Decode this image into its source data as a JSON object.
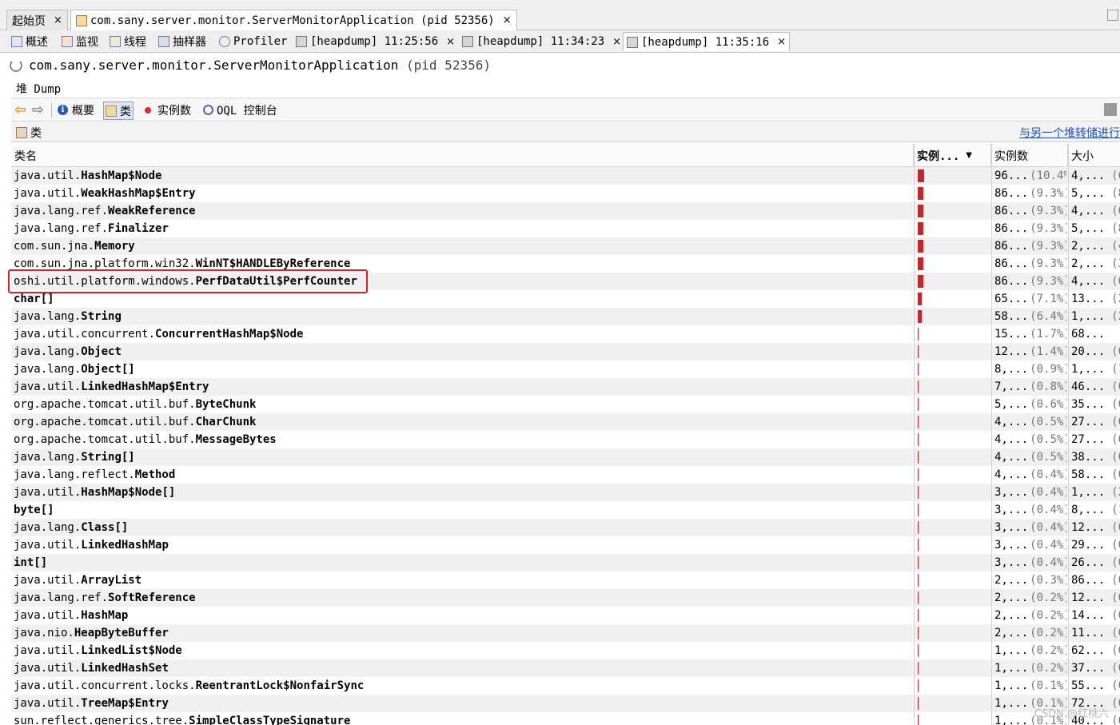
{
  "top_tabs": [
    {
      "label": "起始页",
      "close": "×"
    },
    {
      "label": "com.sany.server.monitor.ServerMonitorApplication (pid 52356)",
      "close": "×"
    }
  ],
  "sub_tabs": [
    {
      "label": "概述",
      "icon": "overview-icon"
    },
    {
      "label": "监视",
      "icon": "monitor-icon"
    },
    {
      "label": "线程",
      "icon": "threads-icon"
    },
    {
      "label": "抽样器",
      "icon": "sampler-icon"
    },
    {
      "label": "Profiler",
      "icon": "profiler-icon"
    },
    {
      "label": "[heapdump] 11:25:56",
      "close": "×",
      "icon": "heapdump-icon"
    },
    {
      "label": "[heapdump] 11:34:23",
      "close": "×",
      "icon": "heapdump-icon"
    },
    {
      "label": "[heapdump] 11:35:16",
      "close": "×",
      "icon": "heapdump-icon"
    }
  ],
  "app_title": {
    "name": "com.sany.server.monitor.ServerMonitorApplication",
    "pid": "(pid 52356)"
  },
  "heap_dump_label": "堆 Dump",
  "toolbar": {
    "summary": "概要",
    "classes": "类",
    "instances": "实例数",
    "oql": "OQL 控制台"
  },
  "classes_label": "类",
  "compare_link": "与另一个堆转储进行",
  "columns": {
    "name": "类名",
    "instances_bar": "实例...",
    "instances": "实例数",
    "size": "大小",
    "sort": "▼"
  },
  "rows": [
    {
      "pkg": "java.util.",
      "cls": "HashMap$Node",
      "pct": "(10.4%)",
      "count": "96...",
      "size": "4,...",
      "size_pct": "(6",
      "bar": 1.0
    },
    {
      "pkg": "java.util.",
      "cls": "WeakHashMap$Entry",
      "pct": "(9.3%)",
      "count": "86...",
      "size": "5,...",
      "size_pct": "(8",
      "bar": 0.89
    },
    {
      "pkg": "java.lang.ref.",
      "cls": "WeakReference",
      "pct": "(9.3%)",
      "count": "86...",
      "size": "4,...",
      "size_pct": "(6",
      "bar": 0.89
    },
    {
      "pkg": "java.lang.ref.",
      "cls": "Finalizer",
      "pct": "(9.3%)",
      "count": "86...",
      "size": "5,...",
      "size_pct": "(8",
      "bar": 0.89
    },
    {
      "pkg": "com.sun.jna.",
      "cls": "Memory",
      "pct": "(9.3%)",
      "count": "86...",
      "size": "2,...",
      "size_pct": "(4",
      "bar": 0.89
    },
    {
      "pkg": "com.sun.jna.platform.win32.",
      "cls": "WinNT$HANDLEByReference",
      "pct": "(9.3%)",
      "count": "86...",
      "size": "2,...",
      "size_pct": "(3",
      "bar": 0.89
    },
    {
      "pkg": "oshi.util.platform.windows.",
      "cls": "PerfDataUtil$PerfCounter",
      "pct": "(9.3%)",
      "count": "86...",
      "size": "4,...",
      "size_pct": "(6",
      "bar": 0.89
    },
    {
      "pkg": "",
      "cls": "char[]",
      "pct": "(7.1%)",
      "count": "65...",
      "size": "13...",
      "size_pct": "(20",
      "bar": 0.68
    },
    {
      "pkg": "java.lang.",
      "cls": "String",
      "pct": "(6.4%)",
      "count": "58...",
      "size": "1,...",
      "size_pct": "(2",
      "bar": 0.61
    },
    {
      "pkg": "java.util.concurrent.",
      "cls": "ConcurrentHashMap$Node",
      "pct": "(1.7%)",
      "count": "15...",
      "size": "68...",
      "size_pct": "",
      "bar": 0.16
    },
    {
      "pkg": "java.lang.",
      "cls": "Object",
      "pct": "(1.4%)",
      "count": "12...",
      "size": "20...",
      "size_pct": "(0",
      "bar": 0.13
    },
    {
      "pkg": "java.lang.",
      "cls": "Object[]",
      "pct": "(0.9%)",
      "count": "8,...",
      "size": "1,...",
      "size_pct": "(1",
      "bar": 0.09
    },
    {
      "pkg": "java.util.",
      "cls": "LinkedHashMap$Entry",
      "pct": "(0.8%)",
      "count": "7,...",
      "size": "46...",
      "size_pct": "(0",
      "bar": 0.08
    },
    {
      "pkg": "org.apache.tomcat.util.buf.",
      "cls": "ByteChunk",
      "pct": "(0.6%)",
      "count": "5,...",
      "size": "35...",
      "size_pct": "(0",
      "bar": 0.06
    },
    {
      "pkg": "org.apache.tomcat.util.buf.",
      "cls": "CharChunk",
      "pct": "(0.5%)",
      "count": "4,...",
      "size": "27...",
      "size_pct": "(0",
      "bar": 0.0
    },
    {
      "pkg": "org.apache.tomcat.util.buf.",
      "cls": "MessageBytes",
      "pct": "(0.5%)",
      "count": "4,...",
      "size": "27...",
      "size_pct": "(0",
      "bar": 0.0
    },
    {
      "pkg": "java.lang.",
      "cls": "String[]",
      "pct": "(0.5%)",
      "count": "4,...",
      "size": "38...",
      "size_pct": "(0",
      "bar": 0.0
    },
    {
      "pkg": "java.lang.reflect.",
      "cls": "Method",
      "pct": "(0.4%)",
      "count": "4,...",
      "size": "58...",
      "size_pct": "(0",
      "bar": 0.0
    },
    {
      "pkg": "java.util.",
      "cls": "HashMap$Node[]",
      "pct": "(0.4%)",
      "count": "3,...",
      "size": "1,...",
      "size_pct": "(2",
      "bar": 0.0
    },
    {
      "pkg": "",
      "cls": "byte[]",
      "pct": "(0.4%)",
      "count": "3,...",
      "size": "8,...",
      "size_pct": "(13",
      "bar": 0.0
    },
    {
      "pkg": "java.lang.",
      "cls": "Class[]",
      "pct": "(0.4%)",
      "count": "3,...",
      "size": "12...",
      "size_pct": "(0",
      "bar": 0.0
    },
    {
      "pkg": "java.util.",
      "cls": "LinkedHashMap",
      "pct": "(0.4%)",
      "count": "3,...",
      "size": "29...",
      "size_pct": "(0",
      "bar": 0.0
    },
    {
      "pkg": "",
      "cls": "int[]",
      "pct": "(0.4%)",
      "count": "3,...",
      "size": "26...",
      "size_pct": "(0",
      "bar": 0.0
    },
    {
      "pkg": "java.util.",
      "cls": "ArrayList",
      "pct": "(0.3%)",
      "count": "2,...",
      "size": "86...",
      "size_pct": "(0",
      "bar": 0.0
    },
    {
      "pkg": "java.lang.ref.",
      "cls": "SoftReference",
      "pct": "(0.2%)",
      "count": "2,...",
      "size": "12...",
      "size_pct": "(0",
      "bar": 0.0
    },
    {
      "pkg": "java.util.",
      "cls": "HashMap",
      "pct": "(0.2%)",
      "count": "2,...",
      "size": "14...",
      "size_pct": "(0",
      "bar": 0.0
    },
    {
      "pkg": "java.nio.",
      "cls": "HeapByteBuffer",
      "pct": "(0.2%)",
      "count": "2,...",
      "size": "11...",
      "size_pct": "(0",
      "bar": 0.0
    },
    {
      "pkg": "java.util.",
      "cls": "LinkedList$Node",
      "pct": "(0.2%)",
      "count": "1,...",
      "size": "62...",
      "size_pct": "(0",
      "bar": 0.0
    },
    {
      "pkg": "java.util.",
      "cls": "LinkedHashSet",
      "pct": "(0.2%)",
      "count": "1,...",
      "size": "37...",
      "size_pct": "(0",
      "bar": 0.0
    },
    {
      "pkg": "java.util.concurrent.locks.",
      "cls": "ReentrantLock$NonfairSync",
      "pct": "(0.1%)",
      "count": "1,...",
      "size": "55...",
      "size_pct": "(0",
      "bar": 0.0
    },
    {
      "pkg": "java.util.",
      "cls": "TreeMap$Entry",
      "pct": "(0.1%)",
      "count": "1,...",
      "size": "72...",
      "size_pct": "(0",
      "bar": 0.0
    },
    {
      "pkg": "sun.reflect.generics.tree.",
      "cls": "SimpleClassTypeSignature",
      "pct": "(0.1%)",
      "count": "1,...",
      "size": "40...",
      "size_pct": "(0",
      "bar": 0.0
    }
  ],
  "watermark": "CSDN @红桃六",
  "colors": {
    "bar": "#c0282d",
    "highlight": "#e02020",
    "link": "#1a4fd6"
  }
}
